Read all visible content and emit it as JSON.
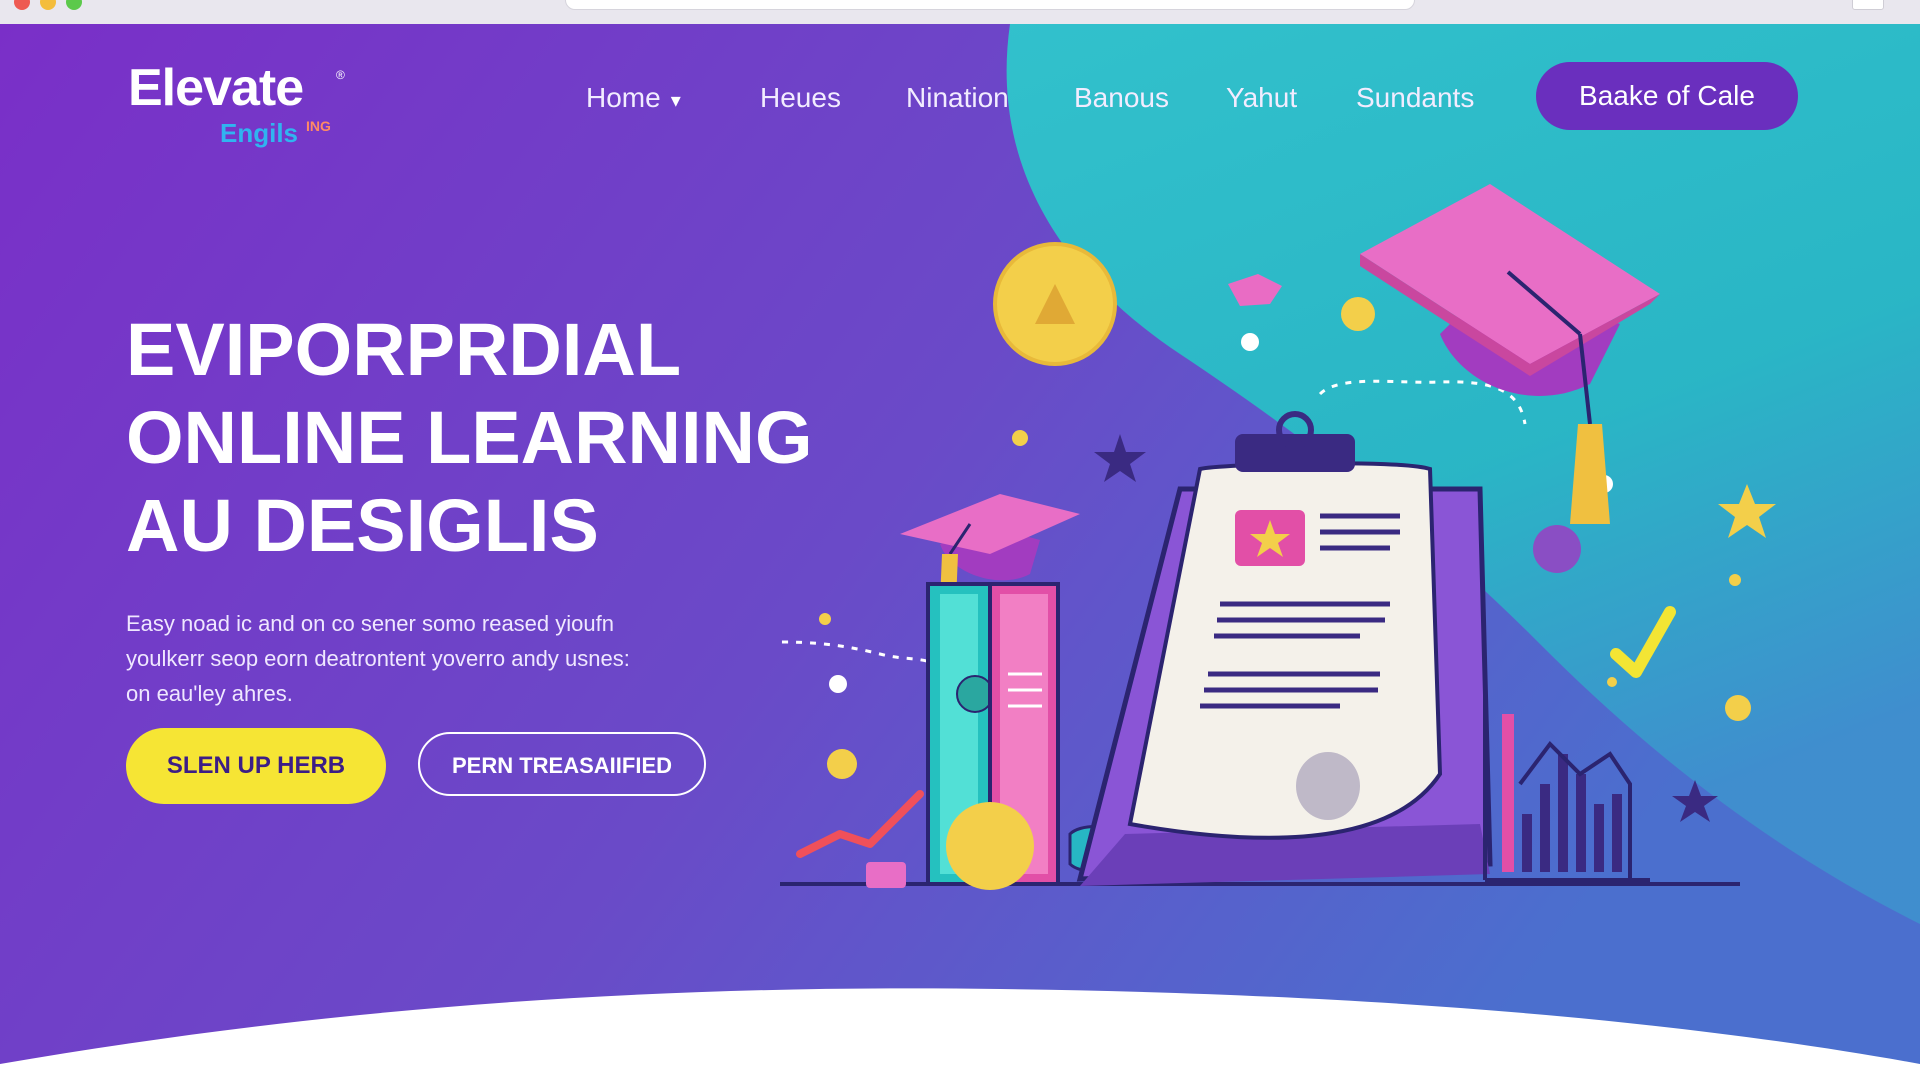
{
  "nav": {
    "logo": "Elevate",
    "logo_registered": "®",
    "logo_sub": "Engils",
    "logo_sub_sup": "ING",
    "items": [
      {
        "label": "Home",
        "has_dropdown": true
      },
      {
        "label": "Heues"
      },
      {
        "label": "Nination"
      },
      {
        "label": "Banous"
      },
      {
        "label": "Yahut"
      },
      {
        "label": "Sundants"
      }
    ],
    "cta_label": "Baake of Cale"
  },
  "hero": {
    "title_lines": [
      "EVIPORPRDIAL",
      "ONLINE LEARNING",
      "AU DESIGLIS"
    ],
    "description_lines": [
      "Easy noad ic and on co sener somo reased yioufn",
      "youlkerr seop eorn deatrontent yoverro andy usnes:",
      "on eau'ley ahres."
    ],
    "primary_button": "SLEN UP HERB",
    "secondary_button": "PERN TREASAIIFIED"
  },
  "colors": {
    "purple": "#7b33c9",
    "teal": "#27c3c6",
    "yellow": "#f6e534",
    "pink": "#e85bb8",
    "navy": "#3a2a82"
  },
  "icons": [
    "chevron-down-icon",
    "graduation-cap-icon",
    "clipboard-icon",
    "star-icon",
    "checkmark-icon",
    "bar-chart-icon",
    "trend-line-icon",
    "coin-icon"
  ]
}
